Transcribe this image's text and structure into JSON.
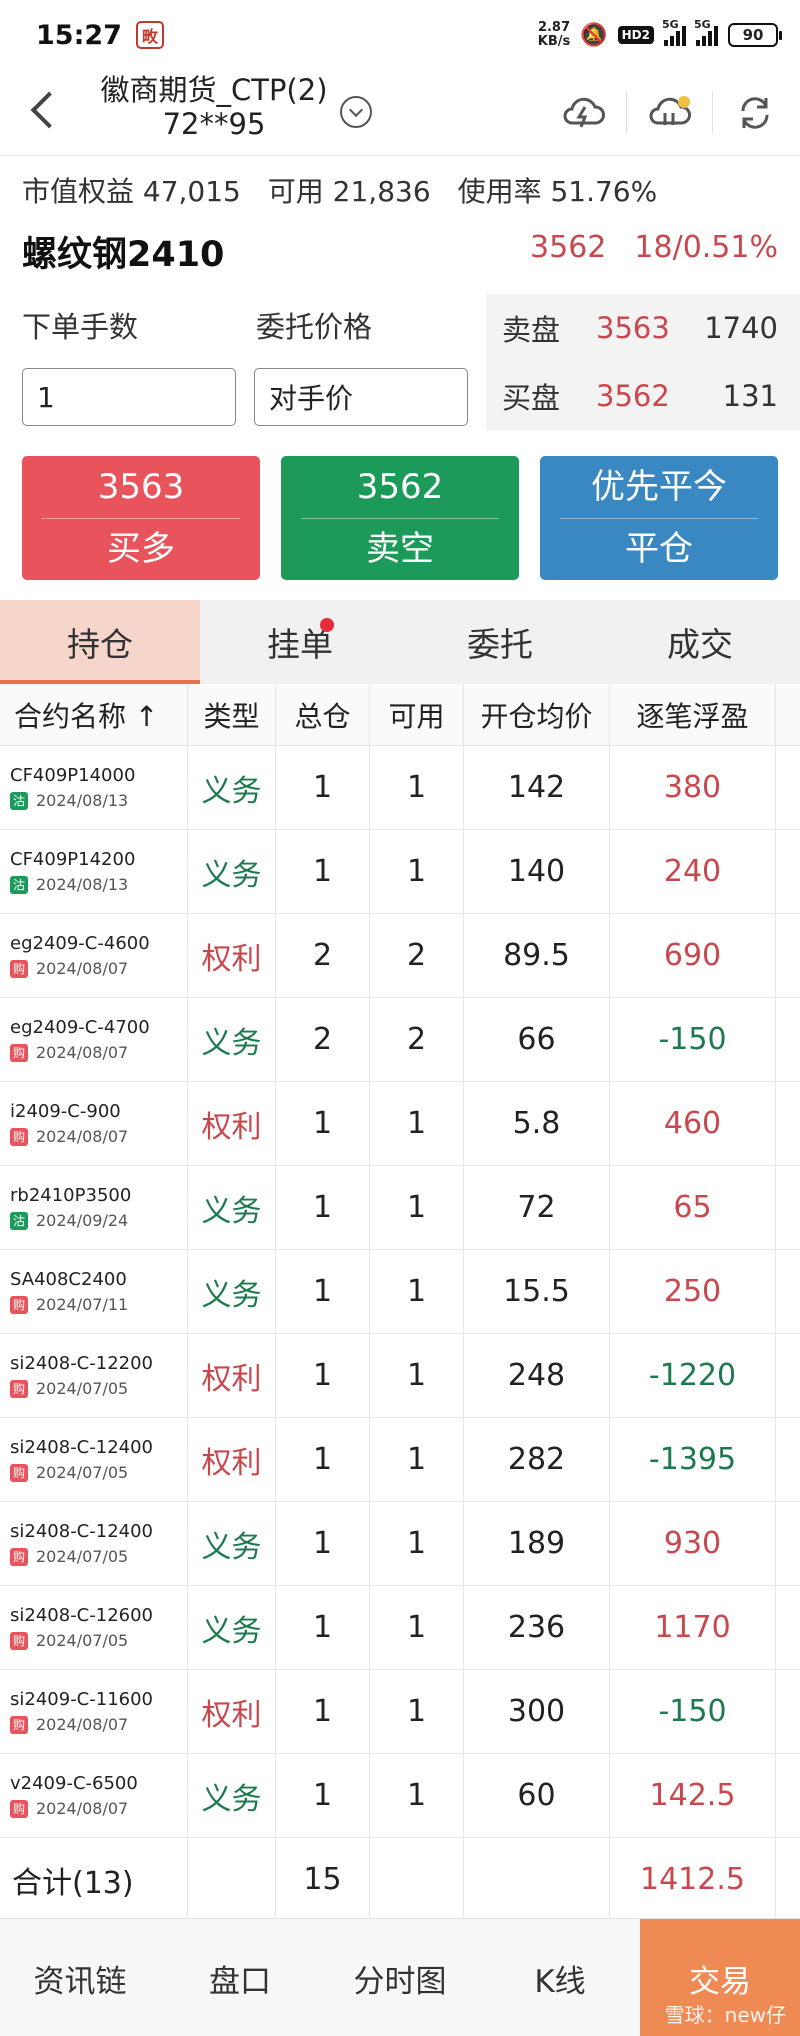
{
  "status_bar": {
    "time": "15:27",
    "app_icon_char": "畋",
    "net_speed_value": "2.87",
    "net_speed_unit": "KB/s",
    "hd_label": "HD2",
    "signal1_label": "5G",
    "signal2_label": "5G",
    "battery": "90"
  },
  "header": {
    "account_name": "徽商期货_CTP(2)",
    "account_id": "72**95"
  },
  "summary": {
    "equity": "市值权益 47,015",
    "available": "可用 21,836",
    "usage": "使用率 51.76%"
  },
  "contract": {
    "name": "螺纹钢2410",
    "last_price": "3562",
    "change": "18/0.51%"
  },
  "order": {
    "qty_label": "下单手数",
    "qty_value": "1",
    "price_label": "委托价格",
    "price_value": "对手价"
  },
  "book": {
    "ask_label": "卖盘",
    "ask_price": "3563",
    "ask_volume": "1740",
    "bid_label": "买盘",
    "bid_price": "3562",
    "bid_volume": "131"
  },
  "buttons": {
    "buy_price": "3563",
    "buy_label": "买多",
    "sell_price": "3562",
    "sell_label": "卖空",
    "close_top": "优先平今",
    "close_label": "平仓"
  },
  "tabs": [
    "持仓",
    "挂单",
    "委托",
    "成交"
  ],
  "table": {
    "headers": [
      "合约名称 ↑",
      "类型",
      "总仓",
      "可用",
      "开仓均价",
      "逐笔浮盈"
    ],
    "rows": [
      {
        "name": "CF409P14000",
        "badge": "沽",
        "date": "2024/08/13",
        "type": "义务",
        "total": "1",
        "avail": "1",
        "avg": "142",
        "pnl": "380"
      },
      {
        "name": "CF409P14200",
        "badge": "沽",
        "date": "2024/08/13",
        "type": "义务",
        "total": "1",
        "avail": "1",
        "avg": "140",
        "pnl": "240"
      },
      {
        "name": "eg2409-C-4600",
        "badge": "购",
        "date": "2024/08/07",
        "type": "权利",
        "total": "2",
        "avail": "2",
        "avg": "89.5",
        "pnl": "690"
      },
      {
        "name": "eg2409-C-4700",
        "badge": "购",
        "date": "2024/08/07",
        "type": "义务",
        "total": "2",
        "avail": "2",
        "avg": "66",
        "pnl": "-150"
      },
      {
        "name": "i2409-C-900",
        "badge": "购",
        "date": "2024/08/07",
        "type": "权利",
        "total": "1",
        "avail": "1",
        "avg": "5.8",
        "pnl": "460"
      },
      {
        "name": "rb2410P3500",
        "badge": "沽",
        "date": "2024/09/24",
        "type": "义务",
        "total": "1",
        "avail": "1",
        "avg": "72",
        "pnl": "65"
      },
      {
        "name": "SA408C2400",
        "badge": "购",
        "date": "2024/07/11",
        "type": "义务",
        "total": "1",
        "avail": "1",
        "avg": "15.5",
        "pnl": "250"
      },
      {
        "name": "si2408-C-12200",
        "badge": "购",
        "date": "2024/07/05",
        "type": "权利",
        "total": "1",
        "avail": "1",
        "avg": "248",
        "pnl": "-1220"
      },
      {
        "name": "si2408-C-12400",
        "badge": "购",
        "date": "2024/07/05",
        "type": "权利",
        "total": "1",
        "avail": "1",
        "avg": "282",
        "pnl": "-1395"
      },
      {
        "name": "si2408-C-12400",
        "badge": "购",
        "date": "2024/07/05",
        "type": "义务",
        "total": "1",
        "avail": "1",
        "avg": "189",
        "pnl": "930"
      },
      {
        "name": "si2408-C-12600",
        "badge": "购",
        "date": "2024/07/05",
        "type": "义务",
        "total": "1",
        "avail": "1",
        "avg": "236",
        "pnl": "1170"
      },
      {
        "name": "si2409-C-11600",
        "badge": "购",
        "date": "2024/08/07",
        "type": "权利",
        "total": "1",
        "avail": "1",
        "avg": "300",
        "pnl": "-150"
      },
      {
        "name": "v2409-C-6500",
        "badge": "购",
        "date": "2024/08/07",
        "type": "义务",
        "total": "1",
        "avail": "1",
        "avg": "60",
        "pnl": "142.5"
      }
    ],
    "total_label": "合计(13)",
    "total_qty": "15",
    "total_pnl": "1412.5"
  },
  "bottom_nav": [
    "资讯链",
    "盘口",
    "分时图",
    "K线",
    "交易"
  ],
  "watermark": "雪球：new仔",
  "colors": {
    "up": "#c9484e",
    "down": "#1c7a4e",
    "buy": "#e9535c",
    "sell": "#1c9a5a",
    "close": "#3a88c2",
    "accent": "#f08a55",
    "badge_put": "#1c9a5a",
    "badge_call": "#e9535c"
  },
  "icons": {
    "back": "chevron-left-icon",
    "dropdown": "chevron-down-icon",
    "cloud1": "cloud-lightning-icon",
    "cloud2": "cloud-sync-icon",
    "refresh": "refresh-icon"
  }
}
